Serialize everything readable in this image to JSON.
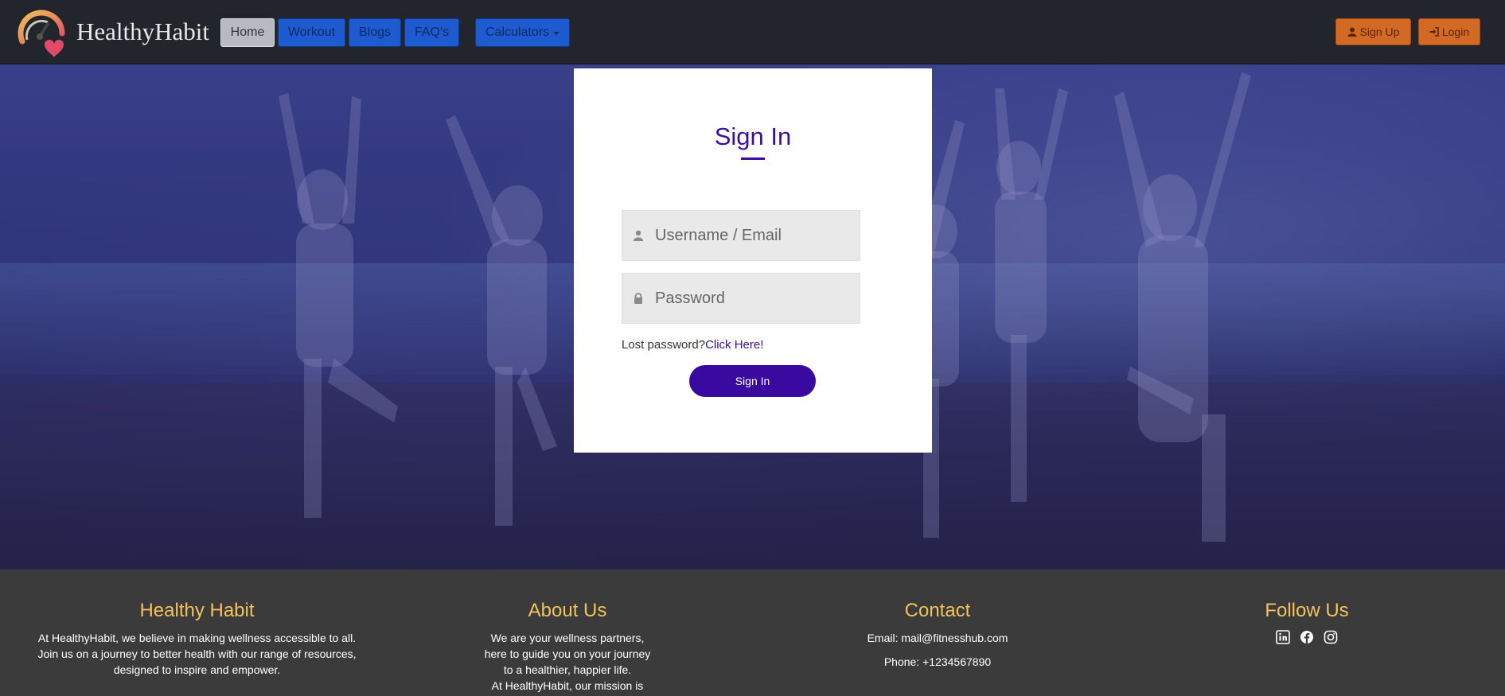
{
  "brand": {
    "name": "HealthyHabit"
  },
  "nav": {
    "home": "Home",
    "workout": "Workout",
    "blogs": "Blogs",
    "faqs": "FAQ's",
    "calculators": "Calculators"
  },
  "auth": {
    "signup": "Sign Up",
    "login": "Login"
  },
  "signin": {
    "title": "Sign In",
    "username_placeholder": "Username / Email",
    "password_placeholder": "Password",
    "lost_password": "Lost password?",
    "click_here": "Click Here!",
    "button": "Sign In"
  },
  "footer": {
    "healthy": {
      "title": "Healthy Habit",
      "lines": [
        "At HealthyHabit, we believe in making wellness accessible to all.",
        "Join us on a journey to better health with our range of resources,",
        "designed to inspire and empower."
      ]
    },
    "about": {
      "title": "About Us",
      "lines": [
        "We are your wellness partners,",
        "here to guide you on your journey",
        "to a healthier, happier life.",
        "At HealthyHabit, our mission is"
      ]
    },
    "contact": {
      "title": "Contact",
      "email": "Email: mail@fitnesshub.com",
      "phone": "Phone: +1234567890"
    },
    "follow": {
      "title": "Follow Us"
    }
  },
  "colors": {
    "accent": "#3a0aa0",
    "nav_button": "#1f5bd0",
    "auth_button": "#d26a25",
    "footer_heading": "#f2c35b"
  },
  "icons": [
    "user-icon",
    "login-icon",
    "person-icon",
    "lock-icon",
    "linkedin-icon",
    "facebook-icon",
    "instagram-icon"
  ]
}
